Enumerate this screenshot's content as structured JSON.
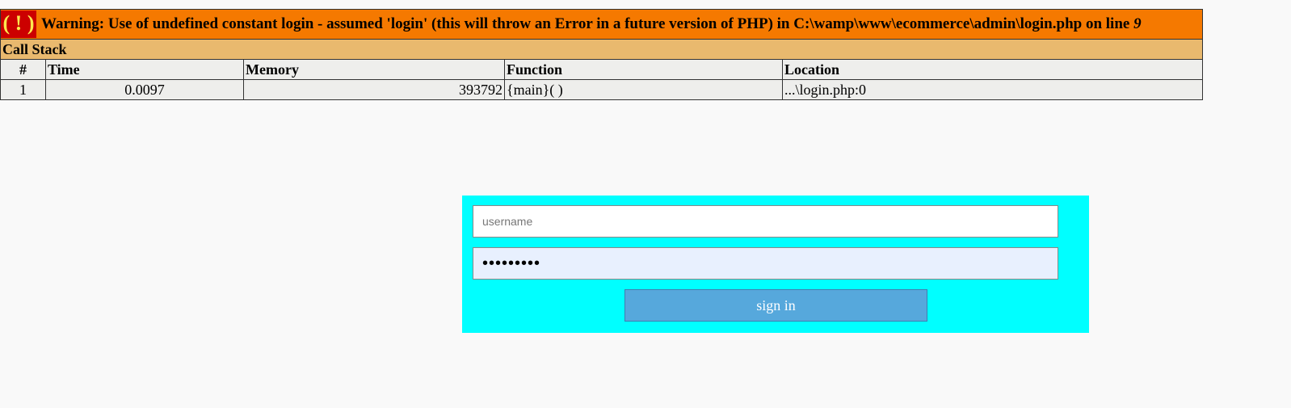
{
  "error": {
    "icon_text": "( ! )",
    "message": "Warning: Use of undefined constant login - assumed 'login' (this will throw an Error in a future version of PHP) in C:\\wamp\\www\\ecommerce\\admin\\login.php on line ",
    "line": "9",
    "callstack_title": "Call Stack",
    "columns": [
      "#",
      "Time",
      "Memory",
      "Function",
      "Location"
    ],
    "rows": [
      {
        "num": "1",
        "time": "0.0097",
        "memory": "393792",
        "function": "{main}( )",
        "location": "...\\login.php:0"
      }
    ]
  },
  "login": {
    "username_placeholder": "username",
    "username_value": "",
    "password_value": "•••••••••",
    "submit_label": "sign in"
  },
  "colors": {
    "warning_bg": "#f57900",
    "callstack_bg": "#e9b96e",
    "panel_bg": "#00ffff",
    "button_bg": "#56a8dc"
  }
}
